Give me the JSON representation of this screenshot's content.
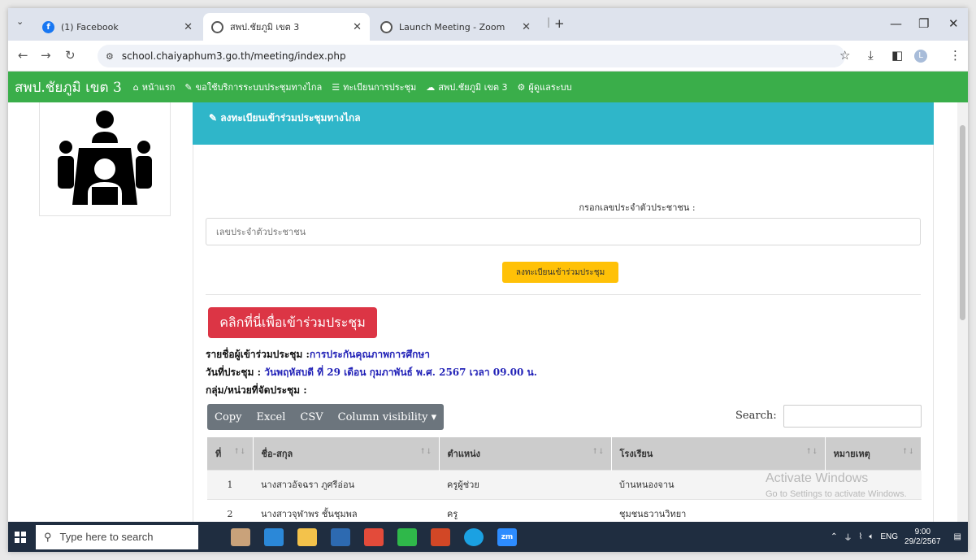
{
  "browser": {
    "tabs": [
      {
        "title": "(1) Facebook",
        "icon": "facebook-icon",
        "active": false
      },
      {
        "title": "สพป.ชัยภูมิ เขต 3",
        "icon": "globe-icon",
        "active": true
      },
      {
        "title": "Launch Meeting - Zoom",
        "icon": "globe-icon",
        "active": false
      }
    ],
    "new_tab": "+",
    "url": "school.chaiyaphum3.go.th/meeting/index.php"
  },
  "site": {
    "brand": "สพป.ชัยภูมิ เขต 3",
    "nav": [
      {
        "label": "หน้าแรก",
        "icon": "home-icon"
      },
      {
        "label": "ขอใช้บริการระบบประชุมทางไกล",
        "icon": "edit-icon"
      },
      {
        "label": "ทะเบียนการประชุม",
        "icon": "list-icon"
      },
      {
        "label": "สพป.ชัยภูมิ เขต 3",
        "icon": "cloud-icon"
      },
      {
        "label": "ผู้ดูแลระบบ",
        "icon": "gear-icon"
      }
    ],
    "accent_green": "#3aae4a",
    "accent_teal": "#2fb6c9"
  },
  "panel": {
    "title": "ลงทะเบียนเข้าร่วมประชุมทางไกล",
    "id_label": "กรอกเลขประจำตัวประชาชน :",
    "id_placeholder": "เลขประจำตัวประชาชน",
    "register_button": "ลงทะเบียนเข้าร่วมประชุม",
    "join_button": "คลิกที่นี่เพื่อเข้าร่วมประชุม",
    "attendee_label": "รายชื่อผู้เข้าร่วมประชุม :",
    "attendee_value": "การประกันคุณภาพการศึกษา",
    "date_label": "วันที่ประชุม :",
    "date_value": "วันพฤหัสบดี ที่ 29 เดือน กุมภาพันธ์ พ.ศ. 2567 เวลา 09.00 น.",
    "group_label": "กลุ่ม/หน่วยที่จัดประชุม :"
  },
  "table": {
    "buttons": [
      "Copy",
      "Excel",
      "CSV",
      "Column visibility ▾"
    ],
    "search_label": "Search:",
    "columns": [
      "ที่",
      "ชื่อ-สกุล",
      "ตำแหน่ง",
      "โรงเรียน",
      "หมายเหตุ"
    ],
    "rows": [
      [
        "1",
        "นางสาวอัจฉรา ภูศรีอ่อน",
        "ครูผู้ช่วย",
        "บ้านหนองจาน",
        ""
      ],
      [
        "2",
        "นางสาวจุฬาพร ชั้นชุมพล",
        "ครู",
        "ชุมชนธวานวิทยา",
        ""
      ]
    ]
  },
  "watermark": {
    "line1": "Activate Windows",
    "line2": "Go to Settings to activate Windows."
  },
  "taskbar": {
    "search_placeholder": "Type here to search",
    "lang": "ENG",
    "time": "9:00",
    "date": "29/2/2567"
  }
}
